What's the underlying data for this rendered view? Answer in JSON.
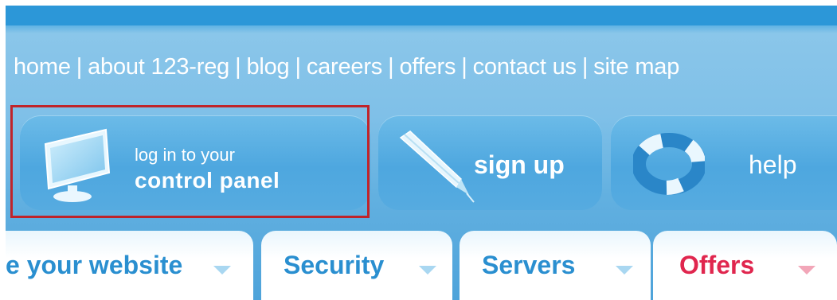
{
  "nav": {
    "links": [
      "home",
      "about 123-reg",
      "blog",
      "careers",
      "offers",
      "contact us",
      "site map"
    ],
    "separator": "|"
  },
  "buttons": {
    "login": {
      "line1": "log in to your",
      "line2": "control panel",
      "icon": "monitor-icon"
    },
    "signup": {
      "label": "sign up",
      "icon": "pencil-icon"
    },
    "help": {
      "label": "help",
      "icon": "lifebuoy-icon"
    }
  },
  "highlight": {
    "target": "login",
    "color": "#c0242a"
  },
  "tabs": [
    {
      "label": "e your website",
      "color": "#2a8fd0",
      "arrow_color": "#a9d7f1"
    },
    {
      "label": "Security",
      "color": "#2a8fd0",
      "arrow_color": "#a9d7f1"
    },
    {
      "label": "Servers",
      "color": "#2a8fd0",
      "arrow_color": "#a9d7f1"
    },
    {
      "label": "Offers",
      "color": "#e0264e",
      "arrow_color": "#f2a6b8"
    }
  ],
  "colors": {
    "topbar": "#2c97d8",
    "background": "#7fc0e8",
    "tab_text": "#2a8fd0",
    "offers_text": "#e0264e"
  }
}
